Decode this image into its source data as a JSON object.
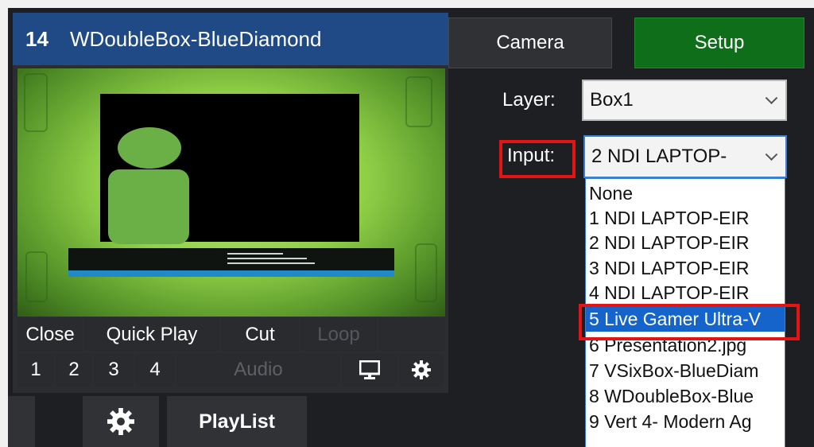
{
  "input_card": {
    "number": "14",
    "name": "WDoubleBox-BlueDiamond",
    "row1": [
      "Close",
      "Quick Play",
      "Cut",
      "Loop"
    ],
    "row2": [
      "1",
      "2",
      "3",
      "4"
    ],
    "audio_label": "Audio"
  },
  "preview": {
    "lower_third_lines": [
      "",
      "",
      ""
    ]
  },
  "bottom_bar": {
    "playlist_label": "PlayList"
  },
  "right_panel": {
    "camera_tab": "Camera",
    "setup_tab": "Setup",
    "layer_label": "Layer:",
    "layer_value": "Box1",
    "input_label": "Input:",
    "input_value": "2 NDI LAPTOP-",
    "input_options": [
      "None",
      "1 NDI LAPTOP-EIR",
      "2 NDI LAPTOP-EIR",
      "3 NDI LAPTOP-EIR",
      "4 NDI LAPTOP-EIR",
      "5 Live Gamer Ultra-V",
      "6 Presentation2.jpg",
      "7 VSixBox-BlueDiam",
      "8 WDoubleBox-Blue",
      "9 Vert 4- Modern Ag"
    ],
    "selected_option_index": 5
  },
  "colors": {
    "title_bar": "#1f4a86",
    "setup_active": "#0f6e1a",
    "selection": "#1464cc",
    "highlight_box": "#e31414"
  }
}
